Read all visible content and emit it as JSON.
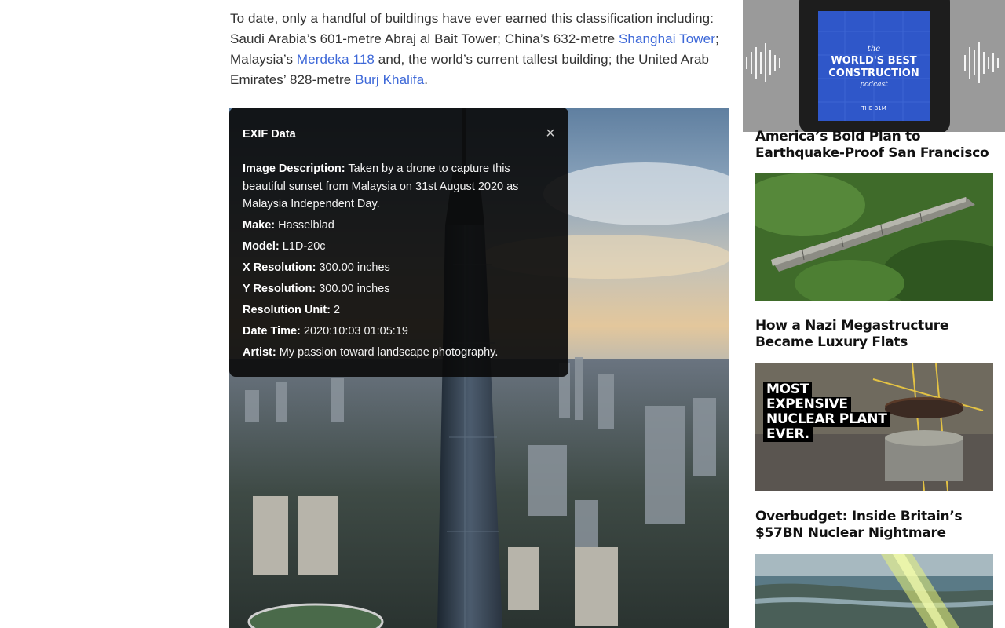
{
  "article": {
    "seg1": "To date, only a handful of buildings have ever earned this classification including: Saudi Arabia’s 601-metre Abraj al Bait Tower; China’s 632-metre ",
    "link1": "Shanghai Tower",
    "seg2": "; Malaysia’s ",
    "link2": "Merdeka 118",
    "seg3": " and, the world’s current tallest building; the United Arab Emirates’ 828-metre ",
    "link3": "Burj Khalifa",
    "seg4": "."
  },
  "exif": {
    "title": "EXIF Data",
    "close": "×",
    "rows": [
      {
        "label": "Image Description:",
        "value": "Taken by a drone to capture this beautiful sunset from Malaysia on 31st August 2020 as Malaysia Independent Day."
      },
      {
        "label": "Make:",
        "value": "Hasselblad"
      },
      {
        "label": "Model:",
        "value": "L1D-20c"
      },
      {
        "label": "X Resolution:",
        "value": "300.00 inches"
      },
      {
        "label": "Y Resolution:",
        "value": "300.00 inches"
      },
      {
        "label": "Resolution Unit:",
        "value": "2"
      },
      {
        "label": "Date Time:",
        "value": "2020:10:03 01:05:19"
      },
      {
        "label": "Artist:",
        "value": "My passion toward landscape photography."
      }
    ]
  },
  "sidebar": {
    "podcast": {
      "line1": "the",
      "line2": "WORLD'S BEST",
      "line3": "CONSTRUCTION",
      "line4": "podcast",
      "brand": "THE B1M"
    },
    "articles": [
      {
        "title": "America’s Bold Plan to Earthquake-Proof San Francisco"
      },
      {
        "title": "How a Nazi Megastructure Became Luxury Flats"
      },
      {
        "title": "Overbudget: Inside Britain’s $57BN Nuclear Nightmare"
      }
    ],
    "nuclear_thumb": {
      "l1": "MOST",
      "l2": "EXPENSIVE",
      "l3": "NUCLEAR PLANT",
      "l4": "EVER."
    }
  },
  "colors": {
    "link": "#3d68d8",
    "popup_bg": "#0a0a0a",
    "podcast_blue": "#2f57c9"
  }
}
